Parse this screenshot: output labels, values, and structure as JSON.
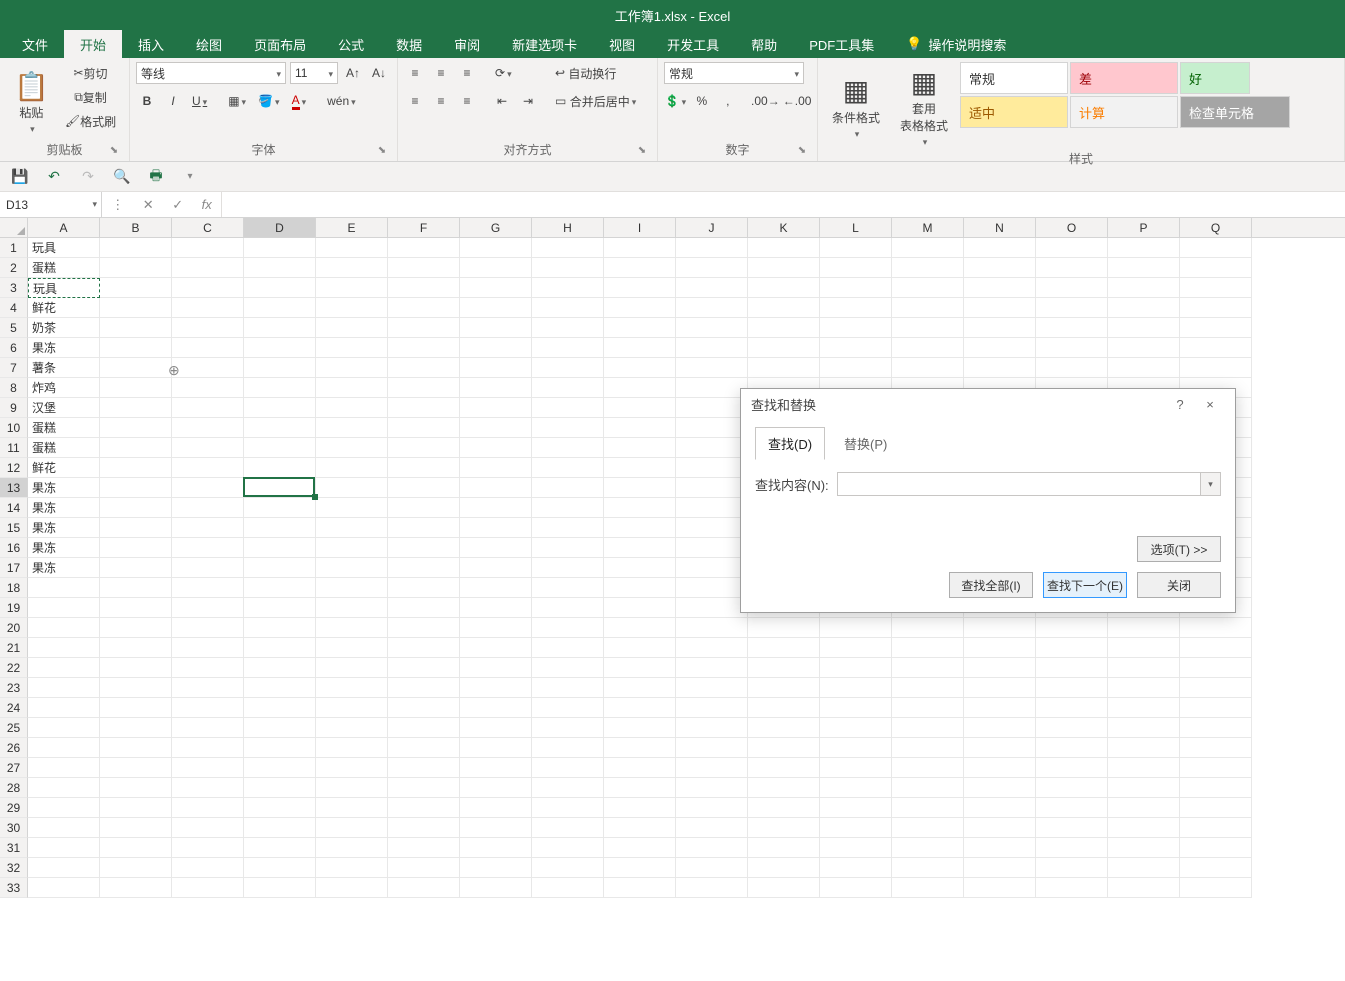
{
  "title_bar": {
    "text": "工作簿1.xlsx - Excel"
  },
  "tabs": {
    "file": "文件",
    "home": "开始",
    "insert": "插入",
    "draw": "绘图",
    "layout": "页面布局",
    "formulas": "公式",
    "data": "数据",
    "review": "审阅",
    "newtab": "新建选项卡",
    "view": "视图",
    "developer": "开发工具",
    "help": "帮助",
    "pdftools": "PDF工具集",
    "tell_me": "操作说明搜索"
  },
  "clipboard": {
    "cut": "剪切",
    "copy": "复制",
    "painter": "格式刷",
    "paste": "粘贴",
    "group": "剪贴板"
  },
  "font": {
    "name": "等线",
    "size": "11",
    "group": "字体"
  },
  "alignment": {
    "wrap": "自动换行",
    "merge": "合并后居中",
    "group": "对齐方式"
  },
  "number": {
    "format": "常规",
    "group": "数字"
  },
  "styles": {
    "cond": "条件格式",
    "table": "套用\n表格格式",
    "normal": "常规",
    "bad": "差",
    "good": "好",
    "neutral": "适中",
    "calc": "计算",
    "check": "检查单元格",
    "group": "样式"
  },
  "name_box": "D13",
  "formula_bar": "",
  "columns": [
    "A",
    "B",
    "C",
    "D",
    "E",
    "F",
    "G",
    "H",
    "I",
    "J",
    "K",
    "L",
    "M",
    "N",
    "O",
    "P",
    "Q"
  ],
  "row_count": 33,
  "selected_col_index": 3,
  "selected_row_index": 12,
  "marching_row_index": 2,
  "cell_data_colA": [
    "玩具",
    "蛋糕",
    "玩具",
    "鲜花",
    "奶茶",
    "果冻",
    "薯条",
    "炸鸡",
    "汉堡",
    "蛋糕",
    "蛋糕",
    "鲜花",
    "果冻",
    "果冻",
    "果冻",
    "果冻",
    "果冻"
  ],
  "dialog": {
    "title": "查找和替换",
    "tab_find": "查找(D)",
    "tab_replace": "替换(P)",
    "find_label": "查找内容(N):",
    "find_value": "",
    "options": "选项(T) >>",
    "find_all": "查找全部(I)",
    "find_next": "查找下一个(E)",
    "close": "关闭",
    "help": "?",
    "x": "×"
  },
  "cursor_cross": "⊕"
}
